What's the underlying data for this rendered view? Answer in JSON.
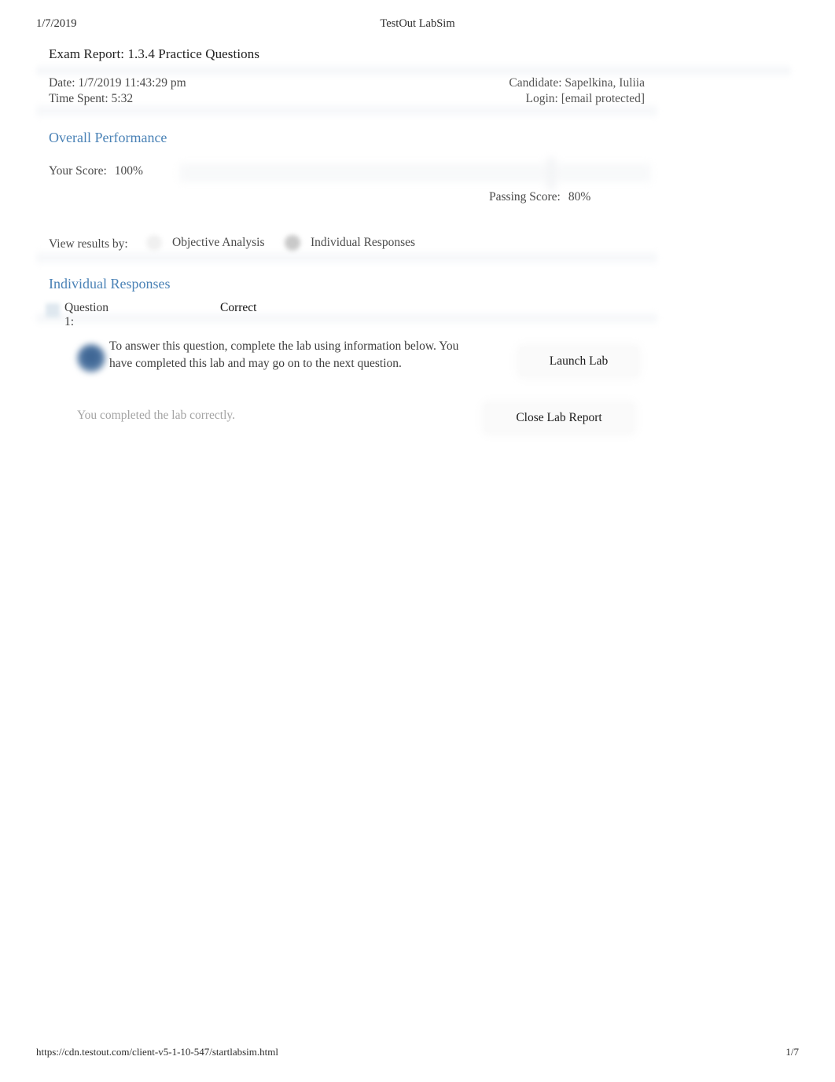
{
  "print_header": {
    "date": "1/7/2019",
    "title": "TestOut LabSim"
  },
  "print_footer": {
    "url": "https://cdn.testout.com/client-v5-1-10-547/startlabsim.html",
    "page": "1/7"
  },
  "report": {
    "title": "Exam Report: 1.3.4 Practice Questions",
    "date_line": "Date: 1/7/2019 11:43:29 pm",
    "time_spent_line": "Time Spent: 5:32",
    "candidate_line": "Candidate: Sapelkina, Iuliia",
    "login_line": "Login: [email protected]"
  },
  "overall_performance": {
    "heading": "Overall Performance",
    "your_score_label": "Your Score:",
    "your_score_value": "100%",
    "passing_score_label": "Passing Score:",
    "passing_score_value": "80%",
    "score_percent": 100,
    "passing_percent": 80
  },
  "view_results": {
    "label": "View results by:",
    "options": [
      {
        "label": "Objective Analysis",
        "selected": false
      },
      {
        "label": "Individual Responses",
        "selected": true
      }
    ]
  },
  "individual_responses": {
    "heading": "Individual Responses",
    "questions": [
      {
        "label": "Question 1:",
        "status": "Correct",
        "body": "To answer this question, complete the lab using information below. You have completed this lab and may go on to the next question.",
        "completion_note": "You completed the lab correctly.",
        "launch_button": "Launch Lab",
        "close_button": "Close Lab Report"
      }
    ]
  },
  "colors": {
    "heading_blue": "#4a82b6",
    "icon_blue": "#4a719e",
    "body_text": "#3d3d3d",
    "muted_text": "#a3a3a3"
  }
}
